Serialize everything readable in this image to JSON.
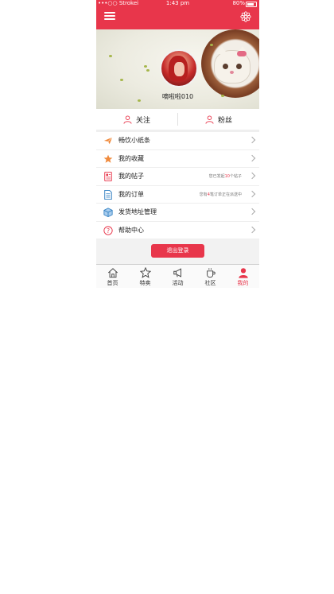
{
  "status_bar": {
    "carrier": "•••○○ Strokei",
    "time": "1:43 pm",
    "battery": "80%"
  },
  "profile": {
    "username": "嘀啦啦010"
  },
  "follow": {
    "following_label": "关注",
    "fans_label": "粉丝"
  },
  "menu": [
    {
      "label": "畅饮小纸条",
      "icon": "paper-plane-icon",
      "hint_pre": "",
      "hint_num": "",
      "hint_post": ""
    },
    {
      "label": "我的收藏",
      "icon": "star-icon",
      "hint_pre": "",
      "hint_num": "",
      "hint_post": ""
    },
    {
      "label": "我的帖子",
      "icon": "document-icon",
      "hint_pre": "您已发起",
      "hint_num": "10",
      "hint_post": "个帖子"
    },
    {
      "label": "我的订单",
      "icon": "order-list-icon",
      "hint_pre": "您有",
      "hint_num": "4",
      "hint_post": "笔订单正在派送中"
    },
    {
      "label": "发货地址管理",
      "icon": "box-icon",
      "hint_pre": "",
      "hint_num": "",
      "hint_post": ""
    },
    {
      "label": "帮助中心",
      "icon": "question-icon",
      "hint_pre": "",
      "hint_num": "",
      "hint_post": ""
    }
  ],
  "logout_label": "退出登录",
  "tabs": [
    {
      "label": "首页",
      "icon": "home-icon",
      "active": false
    },
    {
      "label": "特卖",
      "icon": "star-badge-icon",
      "active": false
    },
    {
      "label": "活动",
      "icon": "megaphone-icon",
      "active": false
    },
    {
      "label": "社区",
      "icon": "cup-icon",
      "active": false
    },
    {
      "label": "我的",
      "icon": "user-icon",
      "active": true
    }
  ],
  "colors": {
    "accent": "#e8364b",
    "orange": "#f08a3c",
    "blue": "#2f7ec1"
  }
}
